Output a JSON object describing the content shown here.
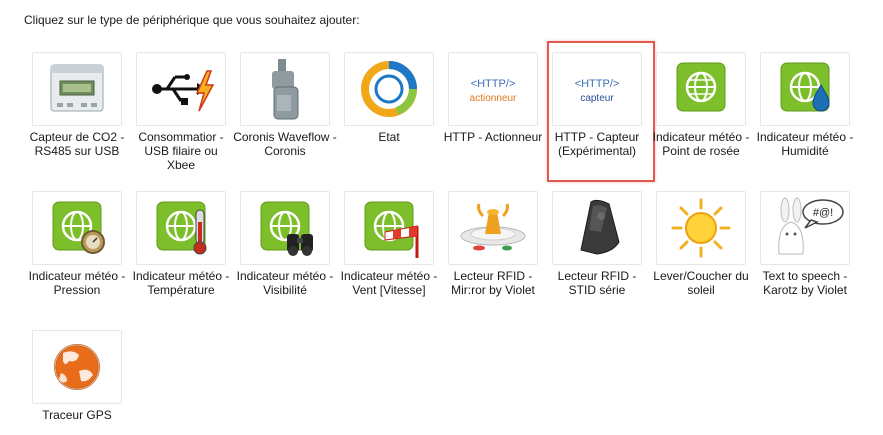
{
  "prompt": "Cliquez sur le type de périphérique que vous souhaitez ajouter:",
  "selected_index": 5,
  "colors": {
    "selection": "#e05a50",
    "weather_green": "#7cbf2a",
    "http_blue": "#3a6fb4",
    "http_orange": "#e0761a"
  },
  "devices": [
    {
      "label": "Capteur de CO2 - RS485 sur USB",
      "icon": "co2-sensor-icon"
    },
    {
      "label": "Consommatior - USB filaire ou Xbee",
      "icon": "usb-power-icon"
    },
    {
      "label": "Coronis Waveflow - Coronis",
      "icon": "waveflow-device-icon"
    },
    {
      "label": "Etat",
      "icon": "state-ring-icon"
    },
    {
      "label": "HTTP - Actionneur",
      "icon": "http-actuator-icon",
      "icon_text": [
        "<HTTP/>",
        "actionneur"
      ]
    },
    {
      "label": "HTTP - Capteur (Expérimental)",
      "icon": "http-sensor-icon",
      "icon_text": [
        "<HTTP/>",
        "capteur"
      ]
    },
    {
      "label": "Indicateur météo - Point de rosée",
      "icon": "weather-globe-icon"
    },
    {
      "label": "Indicateur météo - Humidité",
      "icon": "weather-humidity-icon"
    },
    {
      "label": "Indicateur météo - Pression",
      "icon": "weather-pressure-icon"
    },
    {
      "label": "Indicateur météo - Température",
      "icon": "weather-temperature-icon"
    },
    {
      "label": "Indicateur météo - Visibilité",
      "icon": "weather-visibility-icon"
    },
    {
      "label": "Indicateur météo - Vent [Vitesse]",
      "icon": "weather-wind-icon"
    },
    {
      "label": "Lecteur RFID - Mir:ror by Violet",
      "icon": "mirror-rfid-icon"
    },
    {
      "label": "Lecteur RFID - STID série",
      "icon": "stid-rfid-icon"
    },
    {
      "label": "Lever/Coucher du soleil",
      "icon": "sun-icon"
    },
    {
      "label": "Text to speech - Karotz by Violet",
      "icon": "karotz-rabbit-icon",
      "icon_text": [
        "#@!"
      ]
    },
    {
      "label": "Traceur GPS",
      "icon": "gps-globe-icon"
    }
  ]
}
